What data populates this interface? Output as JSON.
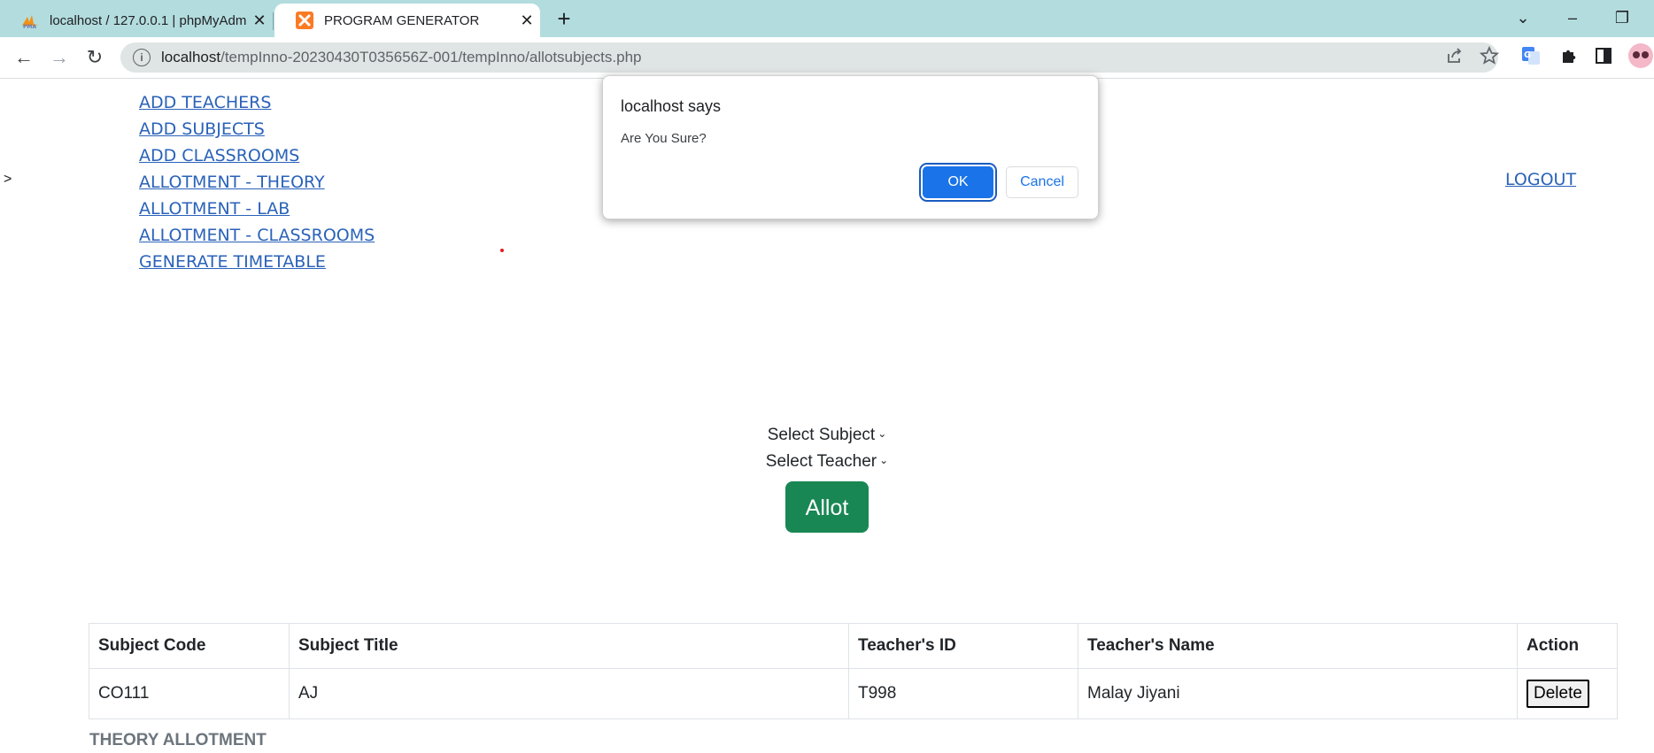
{
  "browser": {
    "tabs": [
      {
        "title": "localhost / 127.0.0.1 | phpMyAdmin",
        "close": "✕",
        "favicon": "phpmyadmin-icon"
      },
      {
        "title": "PROGRAM GENERATOR",
        "close": "✕",
        "favicon": "xampp-icon"
      }
    ],
    "new_tab": "+",
    "window_controls": {
      "dropdown": "⌄",
      "minimize": "–",
      "restore": "❐"
    },
    "nav": {
      "back": "←",
      "forward": "→",
      "reload": "↻"
    },
    "address": {
      "host": "localhost",
      "path": "/tempInno-20230430T035656Z-001/tempInno/allotsubjects.php",
      "info": "i"
    },
    "accent": "#1a73e8",
    "tabbar_color": "#b3dcde"
  },
  "page": {
    "nav_links": [
      "ADD TEACHERS",
      "ADD SUBJECTS",
      "ADD CLASSROOMS",
      "ALLOTMENT - THEORY",
      "ALLOTMENT - LAB",
      "ALLOTMENT - CLASSROOMS",
      "GENERATE TIMETABLE"
    ],
    "stray_char": ">",
    "logout": "LOGOUT",
    "form": {
      "subject_select": "Select Subject",
      "teacher_select": "Select Teacher",
      "chevron": "⌄",
      "allot_button": "Allot",
      "allot_color": "#198754"
    },
    "table": {
      "headers": [
        "Subject Code",
        "Subject Title",
        "Teacher's ID",
        "Teacher's Name",
        "Action"
      ],
      "rows": [
        {
          "code": "CO111",
          "title": "AJ",
          "teacher_id": "T998",
          "teacher_name": "Malay Jiyani",
          "action": "Delete"
        }
      ]
    },
    "caption": "THEORY ALLOTMENT"
  },
  "dialog": {
    "title": "localhost says",
    "message": "Are You Sure?",
    "ok": "OK",
    "cancel": "Cancel"
  }
}
